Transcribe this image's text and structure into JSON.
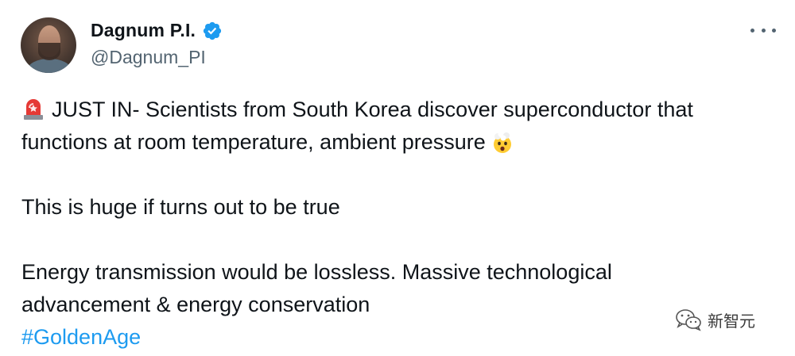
{
  "author": {
    "display_name": "Dagnum P.I.",
    "handle": "@Dagnum_PI",
    "verified": true
  },
  "tweet": {
    "line1": "JUST IN- Scientists from South Korea discover superconductor that",
    "line2": "functions at room temperature, ambient pressure",
    "line3": "This is huge if turns out to be true",
    "line4": "Energy transmission would be lossless. Massive technological",
    "line5": "advancement & energy conservation",
    "hashtag": "#GoldenAge"
  },
  "icons": {
    "siren": "police-light-icon",
    "exploding_head": "exploding-head-emoji-icon",
    "verified": "verified-badge-icon",
    "more": "more-options-icon",
    "watermark": "wechat-icon"
  },
  "watermark": {
    "text": "新智元"
  },
  "colors": {
    "link": "#1d9bf0",
    "verified": "#1d9bf0",
    "text": "#0f1419",
    "muted": "#536471"
  }
}
